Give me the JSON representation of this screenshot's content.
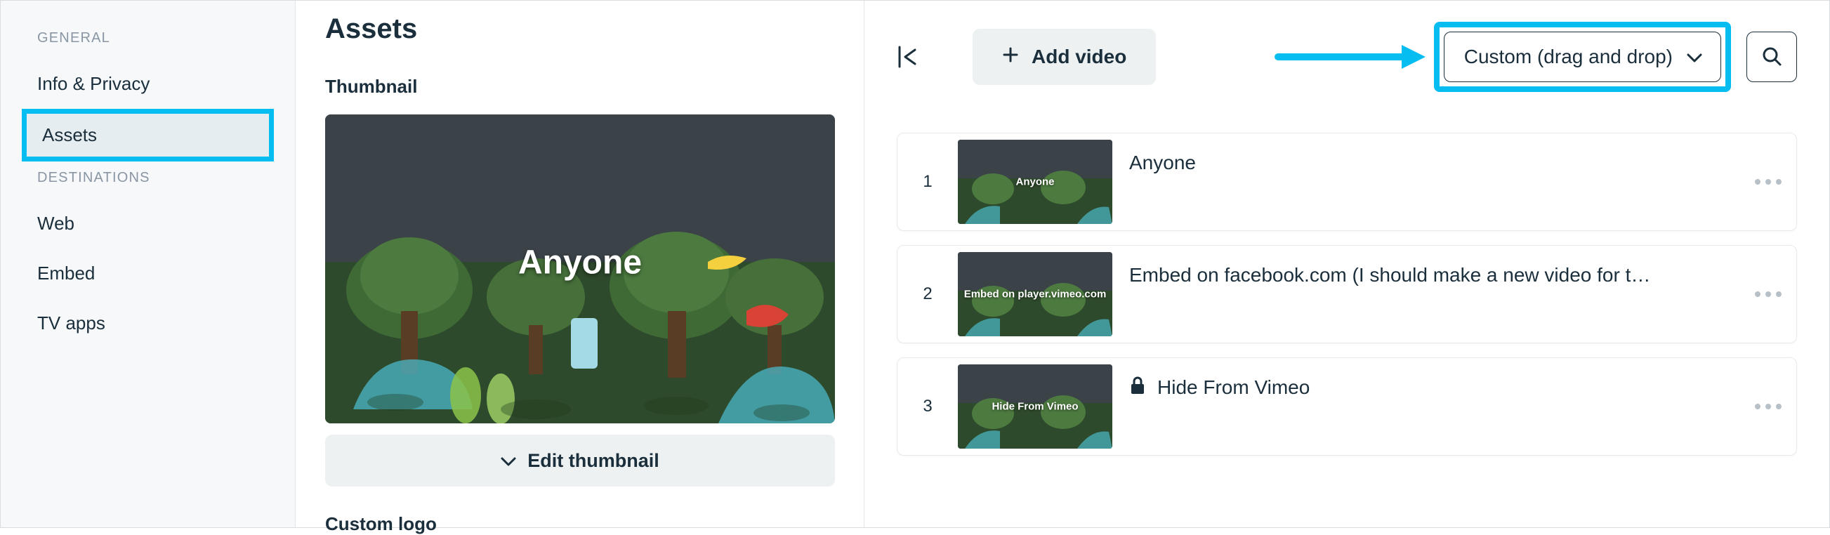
{
  "sidebar": {
    "sections": [
      {
        "label": "GENERAL",
        "items": [
          {
            "label": "Info & Privacy",
            "active": false
          },
          {
            "label": "Assets",
            "active": true
          }
        ]
      },
      {
        "label": "DESTINATIONS",
        "items": [
          {
            "label": "Web",
            "active": false
          },
          {
            "label": "Embed",
            "active": false
          },
          {
            "label": "TV apps",
            "active": false
          }
        ]
      }
    ]
  },
  "middle": {
    "title": "Assets",
    "thumbnail_heading": "Thumbnail",
    "thumbnail_title": "Anyone",
    "edit_thumbnail_label": "Edit thumbnail",
    "custom_logo_heading": "Custom logo"
  },
  "right": {
    "add_video_label": "Add video",
    "sort_dropdown_label": "Custom (drag and drop)",
    "videos": [
      {
        "index": "1",
        "title": "Anyone",
        "thumb_label": "Anyone",
        "locked": false
      },
      {
        "index": "2",
        "title": "Embed on facebook.com (I should make a new video for t…",
        "thumb_label": "Embed on player.vimeo.com",
        "locked": false
      },
      {
        "index": "3",
        "title": "Hide From Vimeo",
        "thumb_label": "Hide From Vimeo",
        "locked": true
      }
    ]
  }
}
